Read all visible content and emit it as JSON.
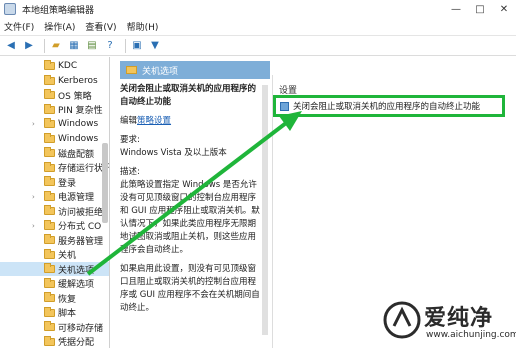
{
  "window": {
    "title": "本地组策略编辑器",
    "controls": [
      "—",
      "□",
      "✕"
    ]
  },
  "menu": [
    "文件(F)",
    "操作(A)",
    "查看(V)",
    "帮助(H)"
  ],
  "toolbar": {
    "icons": [
      "back-icon",
      "forward-icon",
      "up-folder-icon",
      "show-hide-tree-icon",
      "export-icon",
      "help-icon",
      "properties-icon",
      "filter-icon"
    ]
  },
  "tree": {
    "items": [
      {
        "label": "KDC",
        "expandable": false
      },
      {
        "label": "Kerberos",
        "expandable": false
      },
      {
        "label": "OS 策略",
        "expandable": false
      },
      {
        "label": "PIN 复杂性",
        "expandable": false
      },
      {
        "label": "Windows",
        "expandable": true
      },
      {
        "label": "Windows",
        "expandable": false
      },
      {
        "label": "磁盘配额",
        "expandable": false
      },
      {
        "label": "存储运行状况",
        "expandable": false
      },
      {
        "label": "登录",
        "expandable": false
      },
      {
        "label": "电源管理",
        "expandable": true
      },
      {
        "label": "访问被拒绝",
        "expandable": false
      },
      {
        "label": "分布式 CO",
        "expandable": true
      },
      {
        "label": "服务器管理",
        "expandable": false
      },
      {
        "label": "关机",
        "expandable": false
      },
      {
        "label": "关机选项",
        "expandable": false,
        "selected": true
      },
      {
        "label": "缓解选项",
        "expandable": false
      },
      {
        "label": "恢复",
        "expandable": false
      },
      {
        "label": "脚本",
        "expandable": false
      },
      {
        "label": "可移动存储",
        "expandable": false
      },
      {
        "label": "凭据分配",
        "expandable": false
      }
    ]
  },
  "detail": {
    "header": "关机选项",
    "policy_title": "关闭会阻止或取消关机的应用程序的自动终止功能",
    "edit_prefix": "编辑",
    "edit_link": "策略设置",
    "requirements_label": "要求:",
    "requirements": "Windows Vista 及以上版本",
    "description_label": "描述:",
    "description": "此策略设置指定 Windows 是否允许没有可见顶级窗口的控制台应用程序和 GUI 应用程序阻止或取消关机。默认情况下，如果此类应用程序无限期地试图取消或阻止关机，则这些应用程序会自动终止。",
    "description2": "如果启用此设置，则没有可见顶级窗口且阻止或取消关机的控制台应用程序或 GUI 应用程序不会在关机期间自动终止。"
  },
  "settings": {
    "header": "设置",
    "rows": [
      {
        "label": "关闭会阻止或取消关机的应用程序的自动终止功能"
      }
    ]
  },
  "watermark": {
    "text_cn": "爱纯净",
    "text_en": "www.aichunjing.com"
  },
  "colors": {
    "highlight_green": "#1fb53a",
    "header_blue": "#7eaed8",
    "selected_row": "#cce4f7"
  }
}
